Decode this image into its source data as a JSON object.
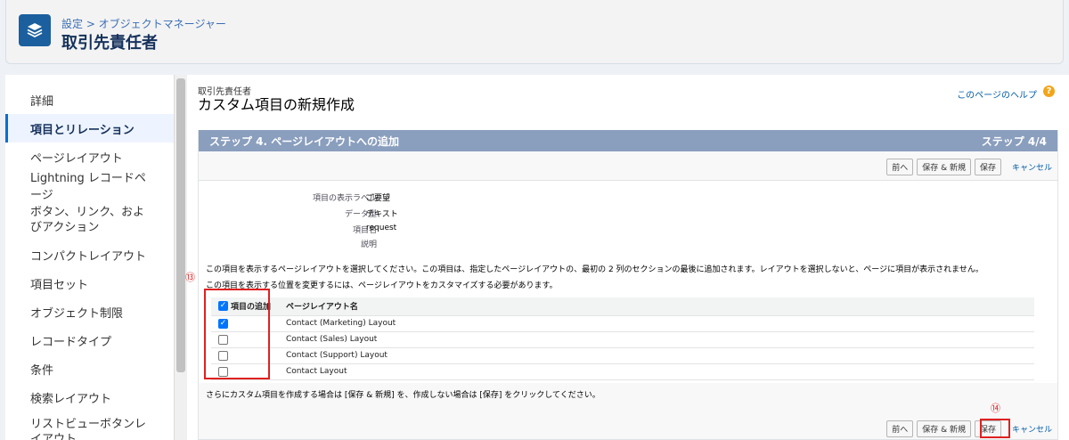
{
  "header": {
    "breadcrumb": "設定 > オブジェクトマネージャー",
    "title": "取引先責任者"
  },
  "sidebar": {
    "items": [
      {
        "label": "詳細"
      },
      {
        "label": "項目とリレーション"
      },
      {
        "label": "ページレイアウト"
      },
      {
        "label": "Lightning レコードページ"
      },
      {
        "label": "ボタン、リンク、およびアクション"
      },
      {
        "label": "コンパクトレイアウト"
      },
      {
        "label": "項目セット"
      },
      {
        "label": "オブジェクト制限"
      },
      {
        "label": "レコードタイプ"
      },
      {
        "label": "条件"
      },
      {
        "label": "検索レイアウト"
      },
      {
        "label": "リストビューボタンレイアウト"
      }
    ]
  },
  "page": {
    "subtitle": "取引先責任者",
    "title": "カスタム項目の新規作成",
    "help_link": "このページのヘルプ",
    "help_icon": "?"
  },
  "step": {
    "title": "ステップ 4. ページレイアウトへの追加",
    "counter": "ステップ 4/4"
  },
  "buttons": {
    "prev": "前へ",
    "save_new": "保存 & 新規",
    "save": "保存",
    "cancel": "キャンセル"
  },
  "fields": [
    {
      "label": "項目の表示ラベル",
      "value": "ご要望"
    },
    {
      "label": "データ型",
      "value": "テキスト"
    },
    {
      "label": "項目名",
      "value": "request"
    },
    {
      "label": "説明",
      "value": ""
    }
  ],
  "notes": {
    "line1": "この項目を表示するページレイアウトを選択してください。この項目は、指定したページレイアウトの、最初の 2 列のセクションの最後に追加されます。レイアウトを選択しないと、ページに項目が表示されません。",
    "line2": "この項目を表示する位置を変更するには、ページレイアウトをカスタマイズする必要があります。",
    "line3": "さらにカスタム項目を作成する場合は [保存 & 新規] を、作成しない場合は [保存] をクリックしてください。"
  },
  "layout_table": {
    "headers": {
      "add": "項目の追加",
      "name": "ページレイアウト名"
    },
    "header_checked": true,
    "rows": [
      {
        "name": "Contact (Marketing) Layout",
        "checked": true
      },
      {
        "name": "Contact (Sales) Layout",
        "checked": false
      },
      {
        "name": "Contact (Support) Layout",
        "checked": false
      },
      {
        "name": "Contact Layout",
        "checked": false
      }
    ]
  },
  "annotations": {
    "marker_13": "⑬",
    "marker_14": "⑭",
    "color": "#e02020"
  },
  "check_glyph": "✓"
}
